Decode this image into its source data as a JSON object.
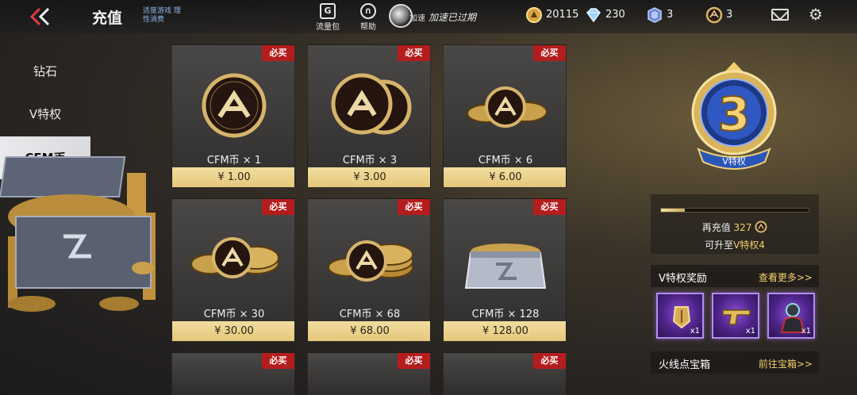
{
  "header": {
    "title": "充值",
    "tagline": "适度游戏 理性消费",
    "traffic_label": "流量包",
    "help_label": "帮助",
    "accelerate_label": "加速",
    "accelerate_status": "加速已过期",
    "currencies": [
      {
        "icon": "gold-coin-icon",
        "value": "20115"
      },
      {
        "icon": "diamond-icon",
        "value": "230"
      },
      {
        "icon": "crystal-icon",
        "value": "3"
      },
      {
        "icon": "cfm-coin-icon",
        "value": "3"
      }
    ]
  },
  "sidebar": {
    "items": [
      {
        "label": "钻石",
        "active": false
      },
      {
        "label": "V特权",
        "active": false
      },
      {
        "label": "CFM币",
        "active": true
      }
    ]
  },
  "products": [
    {
      "badge": "必买",
      "name": "CFM币 × 1",
      "price": "¥ 1.00"
    },
    {
      "badge": "必买",
      "name": "CFM币 × 3",
      "price": "¥ 3.00"
    },
    {
      "badge": "必买",
      "name": "CFM币 × 6",
      "price": "¥ 6.00"
    },
    {
      "badge": "必买",
      "name": "CFM币 × 30",
      "price": "¥ 30.00"
    },
    {
      "badge": "必买",
      "name": "CFM币 × 68",
      "price": "¥ 68.00"
    },
    {
      "badge": "必买",
      "name": "CFM币 × 128",
      "price": "¥ 128.00"
    },
    {
      "badge": "必买",
      "name": "",
      "price": ""
    },
    {
      "badge": "必买",
      "name": "",
      "price": ""
    },
    {
      "badge": "必买",
      "name": "",
      "price": ""
    }
  ],
  "vip": {
    "level": "3",
    "emblem_label": "V特权",
    "progress": 0.16,
    "recharge_prefix": "再充值",
    "recharge_amount": "327",
    "upgrade_prefix": "可升至",
    "upgrade_target": "V特权4"
  },
  "rewards_section": {
    "title": "V特权奖励",
    "more_link": "查看更多>>",
    "items": [
      {
        "icon": "badge-item-icon",
        "qty": "x1"
      },
      {
        "icon": "golden-pistol-icon",
        "qty": "x1"
      },
      {
        "icon": "character-skin-icon",
        "qty": "x1"
      }
    ]
  },
  "chest_section": {
    "title": "火线点宝箱",
    "link": "前往宝箱>>"
  },
  "colors": {
    "accent_gold": "#f2cf6a",
    "badge_red": "#b41d1d",
    "price_bar": "#e5c77b",
    "reward_purple": "#8a4fd6"
  }
}
